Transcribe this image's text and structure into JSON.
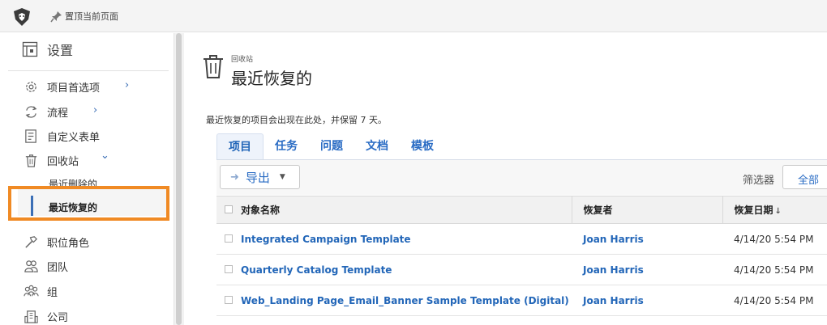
{
  "topbar": {
    "pin_label": "置顶当前页面"
  },
  "sidebar": {
    "header": "设置",
    "items": [
      {
        "label": "项目首选项",
        "icon": "gear-icon",
        "chevron": "›"
      },
      {
        "label": "流程",
        "icon": "flow-icon",
        "chevron": "›"
      },
      {
        "label": "自定义表单",
        "icon": "form-icon"
      },
      {
        "label": "回收站",
        "icon": "trash-icon",
        "chevron": "⌄"
      },
      {
        "label": "职位角色",
        "icon": "hammer-icon"
      },
      {
        "label": "团队",
        "icon": "team-icon"
      },
      {
        "label": "组",
        "icon": "group-icon"
      },
      {
        "label": "公司",
        "icon": "building-icon"
      }
    ],
    "sub_items": [
      {
        "label": "最近删除的"
      },
      {
        "label": "最近恢复的",
        "active": true
      }
    ]
  },
  "main": {
    "breadcrumb": "回收站",
    "title": "最近恢复的",
    "description": "最近恢复的项目会出现在此处，并保留 7 天。",
    "tabs": [
      {
        "label": "项目",
        "active": true
      },
      {
        "label": "任务"
      },
      {
        "label": "问题"
      },
      {
        "label": "文档"
      },
      {
        "label": "模板"
      }
    ],
    "export_label": "导出",
    "filter_label": "筛选器",
    "filter_value": "全部",
    "columns": {
      "name": "对象名称",
      "restored_by": "恢复者",
      "restored_date": "恢复日期"
    },
    "rows": [
      {
        "name": "Integrated Campaign Template",
        "restored_by": "Joan Harris",
        "date": "4/14/20 5:54 PM"
      },
      {
        "name": "Quarterly Catalog Template",
        "restored_by": "Joan Harris",
        "date": "4/14/20 5:54 PM"
      },
      {
        "name": "Web_Landing Page_Email_Banner Sample Template (Digital)",
        "restored_by": "Joan Harris",
        "date": "4/14/20 5:54 PM"
      }
    ]
  },
  "colors": {
    "accent": "#2266b8",
    "highlight": "#f08a24"
  }
}
